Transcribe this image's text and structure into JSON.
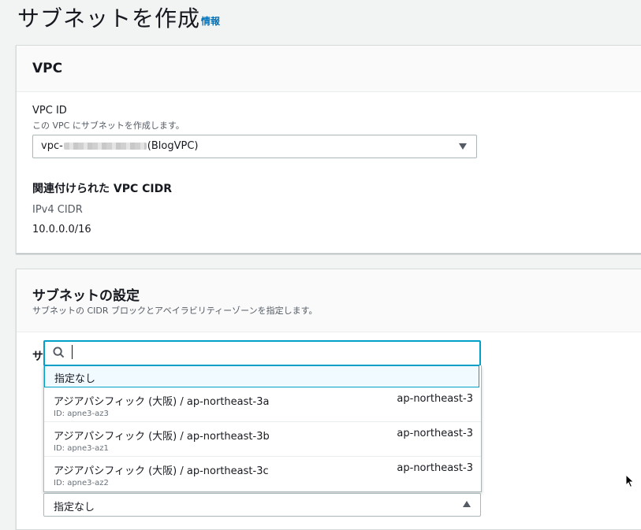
{
  "page": {
    "title": "サブネットを作成",
    "info_link": "情報"
  },
  "vpc_panel": {
    "heading": "VPC",
    "vpc_id_label": "VPC ID",
    "vpc_id_desc": "この VPC にサブネットを作成します。",
    "vpc_select_prefix": "vpc-",
    "vpc_select_suffix": "(BlogVPC)",
    "cidr_heading": "関連付けられた VPC CIDR",
    "ipv4_label": "IPv4 CIDR",
    "ipv4_value": "10.0.0.0/16"
  },
  "subnet_panel": {
    "heading": "サブネットの設定",
    "desc": "サブネットの CIDR ブロックとアベイラビリティーゾーンを指定します。",
    "truncated_label": "サ"
  },
  "az_dropdown": {
    "search_value": "",
    "no_preference": "指定なし",
    "options": [
      {
        "name": "アジアパシフィック (大阪) / ap-northeast-3a",
        "id": "ID: apne3-az3",
        "region": "ap-northeast-3"
      },
      {
        "name": "アジアパシフィック (大阪) / ap-northeast-3b",
        "id": "ID: apne3-az1",
        "region": "ap-northeast-3"
      },
      {
        "name": "アジアパシフィック (大阪) / ap-northeast-3c",
        "id": "ID: apne3-az2",
        "region": "ap-northeast-3"
      }
    ],
    "selected_value": "指定なし"
  },
  "colors": {
    "accent": "#0073bb",
    "focus": "#00a1c9",
    "highlight": "#f1faff"
  }
}
